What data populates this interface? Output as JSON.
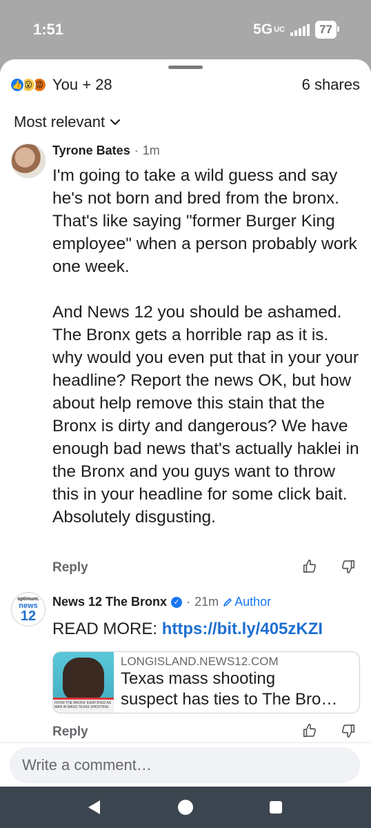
{
  "status_bar": {
    "time": "1:51",
    "network": "5G",
    "network_sub": "UC",
    "battery": "77"
  },
  "reactions": {
    "icons": [
      "like",
      "wow",
      "angry"
    ],
    "text": "You + 28",
    "shares": "6 shares"
  },
  "sort": {
    "label": "Most relevant"
  },
  "comments": [
    {
      "author": "Tyrone Bates",
      "separator": "·",
      "time": "1m",
      "text": "I'm going to take a wild guess and say he's not born and bred from the bronx. That's like saying \"former Burger King employee\" when a person probably work one week.\n\nAnd News 12 you should be ashamed. The Bronx gets a horrible rap as it is. why would you even put that in your your headline? Report the news OK, but how about help remove this stain that the Bronx is dirty and dangerous? We have enough bad news that's actually haklei in the Bronx and you guys want to throw this in your headline for some click bait. Absolutely disgusting.",
      "reply": "Reply"
    },
    {
      "author": "News 12 The Bronx",
      "separator": "·",
      "time": "21m",
      "author_badge": "Author",
      "avatar_top": "optimum.",
      "avatar_mid": "news",
      "avatar_num": "12",
      "read_more_label": "READ MORE:",
      "link_url": "https://bit.ly/405zKZI",
      "card": {
        "domain": "LONGISLAND.NEWS12.COM",
        "title_line1": "Texas mass shooting",
        "title_line2": "suspect has ties to The Bro…",
        "thumb_caption": "FROM THE BRONX IDENTIFIED AS MAN IN MASS TEXAS SHOOTING"
      },
      "reply": "Reply"
    }
  ],
  "composer": {
    "placeholder": "Write a comment…"
  },
  "colors": {
    "accent": "#1877f2",
    "link": "#1d6fd0",
    "nav_bar": "#3b4650",
    "backdrop": "#a8a8a8"
  }
}
